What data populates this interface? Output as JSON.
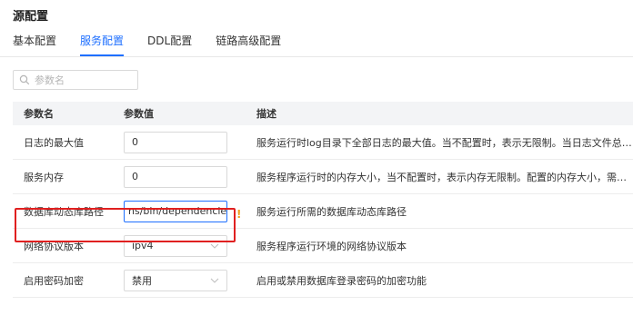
{
  "page": {
    "title": "源配置"
  },
  "tabs": [
    {
      "label": "基本配置",
      "active": false
    },
    {
      "label": "服务配置",
      "active": true
    },
    {
      "label": "DDL配置",
      "active": false
    },
    {
      "label": "链路高级配置",
      "active": false
    }
  ],
  "search": {
    "placeholder": "参数名",
    "icon": "search-icon"
  },
  "table": {
    "headers": {
      "name": "参数名",
      "value": "参数值",
      "desc": "描述"
    },
    "rows": [
      {
        "name": "日志的最大值",
        "value": "0",
        "type": "input",
        "desc": "服务运行时log目录下全部日志的最大值。当不配置时，表示无限制。当日志文件总大小超..."
      },
      {
        "name": "服务内存",
        "value": "0",
        "type": "input",
        "desc": "服务程序运行时的内存大小，当不配置时，表示内存无限制。配置的内存大小，需在当前..."
      },
      {
        "name": "数据库动态库路径",
        "value": "ns/bin/dependencies",
        "type": "input",
        "desc": "服务运行所需的数据库动态库路径",
        "warning": "!"
      },
      {
        "name": "网络协议版本",
        "value": "ipv4",
        "type": "select",
        "desc": "服务程序运行环境的网络协议版本"
      },
      {
        "name": "启用密码加密",
        "value": "禁用",
        "type": "select",
        "desc": "启用或禁用数据库登录密码的加密功能"
      }
    ]
  },
  "colors": {
    "accent": "#1e6fff",
    "highlight": "#e02020",
    "warning": "#f0a020"
  }
}
